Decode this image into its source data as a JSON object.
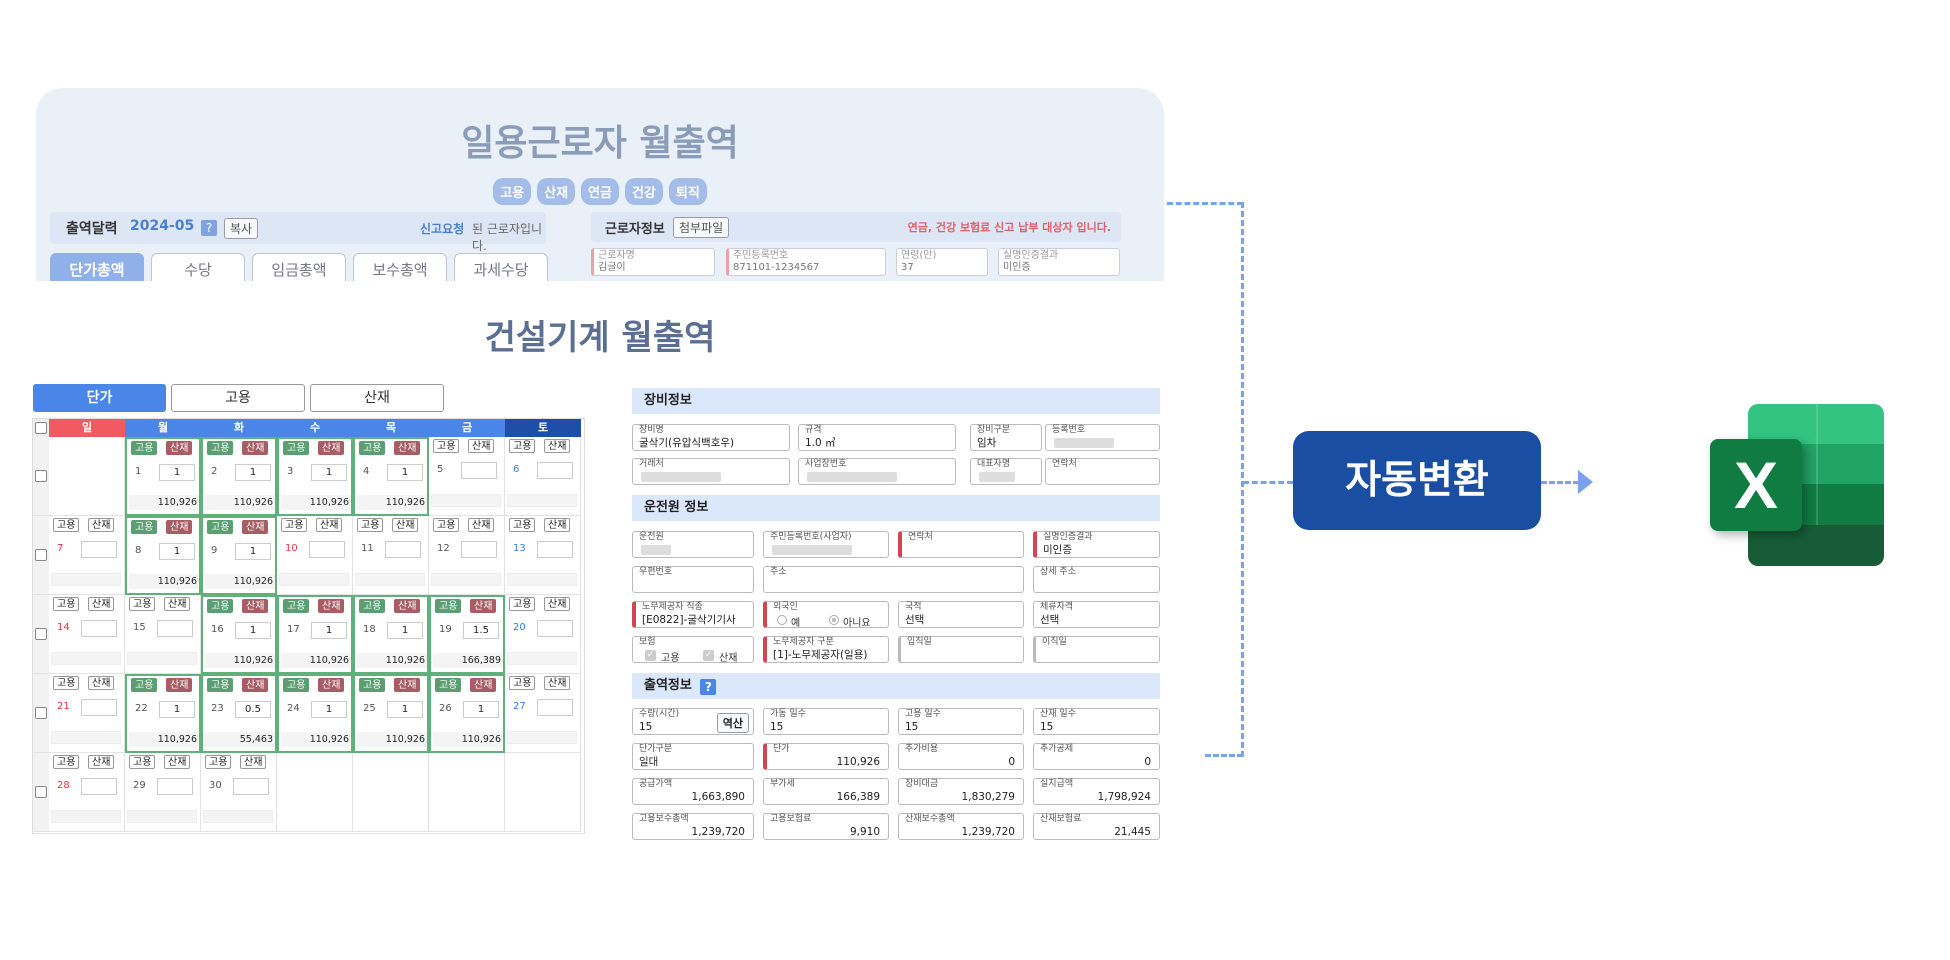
{
  "top_panel": {
    "title": "일용근로자 월출역",
    "tags": [
      "고용",
      "산재",
      "연금",
      "건강",
      "퇴직"
    ],
    "bar_left": {
      "label": "출역달력",
      "month": "2024-05",
      "help": "?",
      "copy_btn": "복사",
      "notice_link": "신고요청",
      "notice_rest": "된 근로자입니다."
    },
    "bar_right": {
      "label": "근로자정보",
      "attach_btn": "첨부파일",
      "warning": "연금, 건강 보험료 신고 납부 대상자 입니다."
    },
    "tabs": [
      "단가총액",
      "수당",
      "임금총액",
      "보수총액",
      "과세수당"
    ],
    "worker_fields": [
      {
        "label": "근로자명",
        "value": "김글이"
      },
      {
        "label": "주민등록번호",
        "value": "871101-1234567"
      },
      {
        "label": "연령(만)",
        "value": "37"
      },
      {
        "label": "실명인증결과",
        "value": "미인증"
      }
    ]
  },
  "main_title": "건설기계 월출역",
  "main_tabs": [
    "단가",
    "고용",
    "산재"
  ],
  "calendar": {
    "weekdays": [
      "일",
      "월",
      "화",
      "수",
      "목",
      "금",
      "토"
    ],
    "weekday_colors": [
      "#f25a61",
      "#4a86e8",
      "#4a86e8",
      "#4a86e8",
      "#4a86e8",
      "#4a86e8",
      "#1f4ea8"
    ],
    "chip_labels": [
      "고용",
      "산재"
    ],
    "weeks": [
      [
        null,
        {
          "day": "",
          "active": true,
          "qty": "1",
          "amt": "110,926",
          "dnum": "1"
        },
        {
          "dnum": "2",
          "active": true,
          "qty": "1",
          "amt": "110,926"
        },
        {
          "dnum": "3",
          "active": true,
          "qty": "1",
          "amt": "110,926"
        },
        {
          "dnum": "4",
          "active": true,
          "qty": "1",
          "amt": "110,926"
        },
        {
          "dnum": "5",
          "active": false,
          "qty": "",
          "amt": ""
        },
        {
          "dnum": "6",
          "active": false,
          "qty": "",
          "amt": "",
          "color": "sat"
        }
      ],
      [
        {
          "dnum": "7",
          "active": false,
          "qty": "",
          "amt": "",
          "color": "sun"
        },
        {
          "dnum": "8",
          "active": true,
          "qty": "1",
          "amt": "110,926"
        },
        {
          "dnum": "9",
          "active": true,
          "qty": "1",
          "amt": "110,926"
        },
        {
          "dnum": "10",
          "active": false,
          "qty": "",
          "amt": "",
          "color": "sun"
        },
        {
          "dnum": "11",
          "active": false,
          "qty": "",
          "amt": ""
        },
        {
          "dnum": "12",
          "active": false,
          "qty": "",
          "amt": ""
        },
        {
          "dnum": "13",
          "active": false,
          "qty": "",
          "amt": "",
          "color": "sat"
        }
      ],
      [
        {
          "dnum": "14",
          "active": false,
          "qty": "",
          "amt": "",
          "color": "sun"
        },
        {
          "dnum": "15",
          "active": false,
          "qty": "",
          "amt": ""
        },
        {
          "dnum": "16",
          "active": true,
          "qty": "1",
          "amt": "110,926"
        },
        {
          "dnum": "17",
          "active": true,
          "qty": "1",
          "amt": "110,926"
        },
        {
          "dnum": "18",
          "active": true,
          "qty": "1",
          "amt": "110,926"
        },
        {
          "dnum": "19",
          "active": true,
          "qty": "1.5",
          "amt": "166,389"
        },
        {
          "dnum": "20",
          "active": false,
          "qty": "",
          "amt": "",
          "color": "sat"
        }
      ],
      [
        {
          "dnum": "21",
          "active": false,
          "qty": "",
          "amt": "",
          "color": "sun"
        },
        {
          "dnum": "22",
          "active": true,
          "qty": "1",
          "amt": "110,926"
        },
        {
          "dnum": "23",
          "active": true,
          "qty": "0.5",
          "amt": "55,463"
        },
        {
          "dnum": "24",
          "active": true,
          "qty": "1",
          "amt": "110,926"
        },
        {
          "dnum": "25",
          "active": true,
          "qty": "1",
          "amt": "110,926"
        },
        {
          "dnum": "26",
          "active": true,
          "qty": "1",
          "amt": "110,926"
        },
        {
          "dnum": "27",
          "active": false,
          "qty": "",
          "amt": "",
          "color": "sat"
        }
      ],
      [
        {
          "dnum": "28",
          "active": false,
          "qty": "",
          "amt": "",
          "color": "sun"
        },
        {
          "dnum": "29",
          "active": false,
          "qty": "",
          "amt": ""
        },
        {
          "dnum": "30",
          "active": false,
          "qty": "",
          "amt": ""
        },
        null,
        null,
        null,
        null
      ]
    ]
  },
  "equipment": {
    "title": "장비정보",
    "fields": {
      "name": {
        "label": "장비명",
        "value": "굴삭기(유압식백호우)"
      },
      "spec": {
        "label": "규격",
        "value": "1.0 ㎥"
      },
      "category": {
        "label": "장비구분",
        "value": "임차"
      },
      "reg_no": {
        "label": "등록번호",
        "value": ""
      },
      "vendor": {
        "label": "거래처",
        "value": ""
      },
      "biz_no": {
        "label": "사업장번호",
        "value": ""
      },
      "rep": {
        "label": "대표자명",
        "value": ""
      },
      "contact": {
        "label": "연락처",
        "value": ""
      }
    }
  },
  "operator": {
    "title": "운전원 정보",
    "fields": {
      "name": {
        "label": "운전원",
        "value": ""
      },
      "rrn": {
        "label": "주민등록번호(사업자)",
        "value": ""
      },
      "phone": {
        "label": "연락처",
        "value": ""
      },
      "verify": {
        "label": "실명인증결과",
        "value": "미인증"
      },
      "zip": {
        "label": "우편번호",
        "value": ""
      },
      "addr": {
        "label": "주소",
        "value": ""
      },
      "addr_detail": {
        "label": "상세 주소",
        "value": ""
      },
      "job": {
        "label": "노무제공자 직종",
        "value": "[E0822]-굴삭기기사"
      },
      "foreigner": {
        "label": "외국인",
        "yes": "예",
        "no": "아니요"
      },
      "nationality": {
        "label": "국적",
        "value": "선택"
      },
      "stay": {
        "label": "체류자격",
        "value": "선택"
      },
      "insurance": {
        "label": "보험",
        "opt1": "고용",
        "opt2": "산재"
      },
      "worker_type": {
        "label": "노무제공자 구분",
        "value": "[1]-노무제공자(일용)"
      },
      "join": {
        "label": "입직일",
        "value": ""
      },
      "leave": {
        "label": "이직일",
        "value": ""
      }
    }
  },
  "work": {
    "title": "출역정보",
    "help": "?",
    "fields": {
      "qty": {
        "label": "수량(시간)",
        "value": "15",
        "btn": "역산"
      },
      "op_days": {
        "label": "가동 일수",
        "value": "15"
      },
      "emp_days": {
        "label": "고용 일수",
        "value": "15"
      },
      "ind_days": {
        "label": "산재 일수",
        "value": "15"
      },
      "unit_type": {
        "label": "단가구분",
        "value": "일대"
      },
      "unit_price": {
        "label": "단가",
        "value": "110,926"
      },
      "extra_cost": {
        "label": "추가비용",
        "value": "0"
      },
      "extra_deduct": {
        "label": "추가공제",
        "value": "0"
      },
      "supply": {
        "label": "공급가액",
        "value": "1,663,890"
      },
      "vat": {
        "label": "부가세",
        "value": "166,389"
      },
      "equip_total": {
        "label": "장비대금",
        "value": "1,830,279"
      },
      "paid": {
        "label": "실지급액",
        "value": "1,798,924"
      },
      "emp_total": {
        "label": "고용보수총액",
        "value": "1,239,720"
      },
      "emp_premium": {
        "label": "고용보험료",
        "value": "9,910"
      },
      "ind_total": {
        "label": "산재보수총액",
        "value": "1,239,720"
      },
      "ind_premium": {
        "label": "산재보험료",
        "value": "21,445"
      }
    }
  },
  "convert_button": "자동변환",
  "excel_icon": {
    "name": "excel-icon",
    "letter": "X"
  }
}
